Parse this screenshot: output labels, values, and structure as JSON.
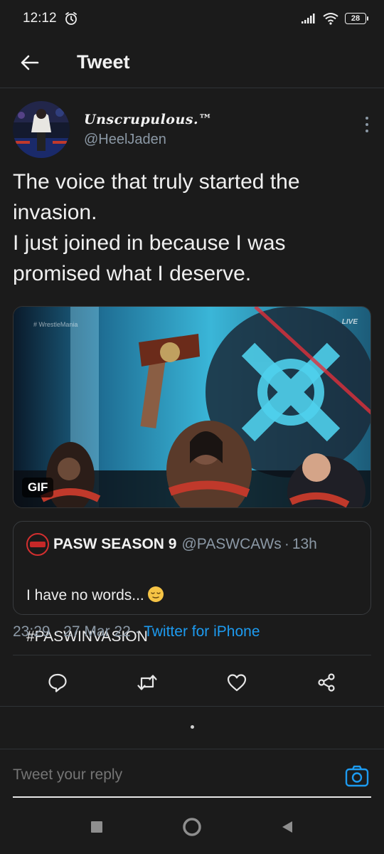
{
  "status_bar": {
    "time": "12:12",
    "battery": "28"
  },
  "header": {
    "title": "Tweet"
  },
  "tweet": {
    "display_name": "Unscrupulous.™",
    "handle": "@HeelJaden",
    "text": "The voice that truly started the invasion.\nI just joined in because I was promised what I deserve.",
    "media": {
      "badge": "GIF",
      "watermark": "# WrestleMania",
      "live_tag": "LIVE"
    },
    "quote": {
      "name": "PASW SEASON 9",
      "handle": "@PASWCAWs",
      "separator": "·",
      "time": "13h",
      "line1": "I have no words...",
      "line2": "#PASWINVASION"
    },
    "meta": {
      "time": "23:29",
      "sep1": " · ",
      "date": "27 Mar 22",
      "sep2": " · ",
      "source": "Twitter for iPhone"
    }
  },
  "reply": {
    "placeholder": "Tweet your reply"
  },
  "icons": {
    "back": "arrow-left-icon",
    "more": "more-vertical-icon",
    "reply": "comment-icon",
    "retweet": "retweet-icon",
    "like": "heart-icon",
    "share": "share-icon",
    "camera": "camera-icon"
  },
  "colors": {
    "background": "#1b1b1b",
    "accent": "#1d9bf0",
    "secondary_text": "#8b98a5"
  }
}
